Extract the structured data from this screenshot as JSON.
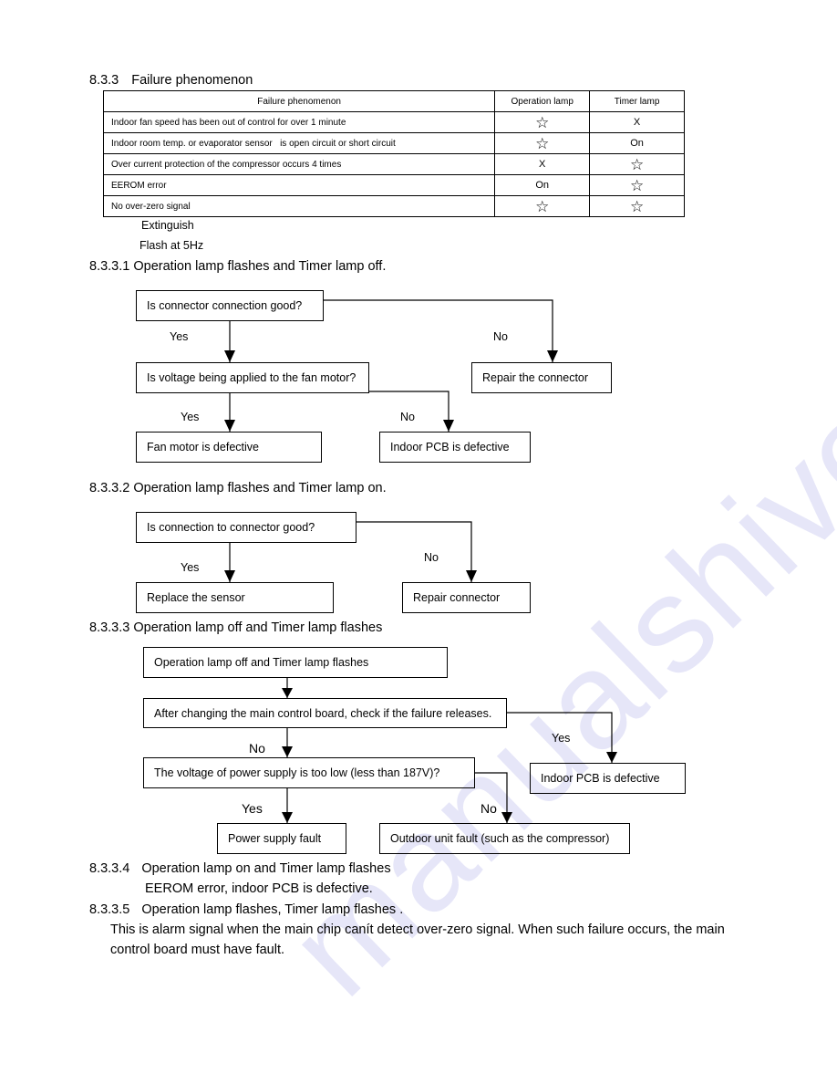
{
  "watermark": "manualshive.com",
  "section": {
    "number": "8.3.3",
    "title": "Failure phenomenon"
  },
  "table": {
    "headers": [
      "Failure phenomenon",
      "Operation lamp",
      "Timer lamp"
    ],
    "rows": [
      {
        "phenomenon": "Indoor fan speed has been out of control for over 1 minute",
        "operation": "☆",
        "timer": "X"
      },
      {
        "phenomenon": "Indoor room temp. or evaporator sensor   is open circuit or short circuit",
        "operation": "☆",
        "timer": "On"
      },
      {
        "phenomenon": "Over current protection of the compressor occurs 4 times",
        "operation": "X",
        "timer": "☆"
      },
      {
        "phenomenon": "EEROM error",
        "operation": "On",
        "timer": "☆"
      },
      {
        "phenomenon": "No over-zero signal",
        "operation": "☆",
        "timer": "☆"
      }
    ]
  },
  "legend": {
    "extinguish": "Extinguish",
    "flash": "Flash at 5Hz"
  },
  "s1": {
    "heading": "8.3.3.1 Operation lamp flashes and Timer lamp off.",
    "q1": "Is connector connection good?",
    "q2": "Is voltage being applied to the fan motor?",
    "repair": "Repair the connector",
    "fan": "Fan motor is defective",
    "pcb": "Indoor PCB is defective",
    "yes1": "Yes",
    "no1": "No",
    "yes2": "Yes",
    "no2": "No"
  },
  "s2": {
    "heading": "8.3.3.2 Operation lamp flashes and Timer lamp on.",
    "q1": "Is connection to connector good?",
    "replace": "Replace the sensor",
    "repair": "Repair connector",
    "yes": "Yes",
    "no": "No"
  },
  "s3": {
    "heading": "8.3.3.3 Operation lamp off and Timer lamp flashes",
    "start": "Operation lamp off and Timer lamp flashes",
    "q1": "After changing the main control board, check if the failure releases.",
    "q2": "The voltage of power supply is too low (less than 187V)?",
    "pcb": "Indoor PCB is defective",
    "power": "Power supply fault",
    "outdoor": "Outdoor unit fault (such as the compressor)",
    "no1": "No",
    "yes1": "Yes",
    "yes2": "Yes",
    "no2": "No"
  },
  "s4": {
    "number": "8.3.3.4",
    "title": "Operation lamp on and Timer lamp flashes",
    "body": "EEROM error, indoor PCB is defective."
  },
  "s5": {
    "number": "8.3.3.5",
    "title": "Operation lamp flashes, Timer lamp flashes .",
    "body1": "This is alarm signal when the main chip canít detect over-zero signal. When such failure occurs, the main",
    "body2": "control board must have fault."
  }
}
